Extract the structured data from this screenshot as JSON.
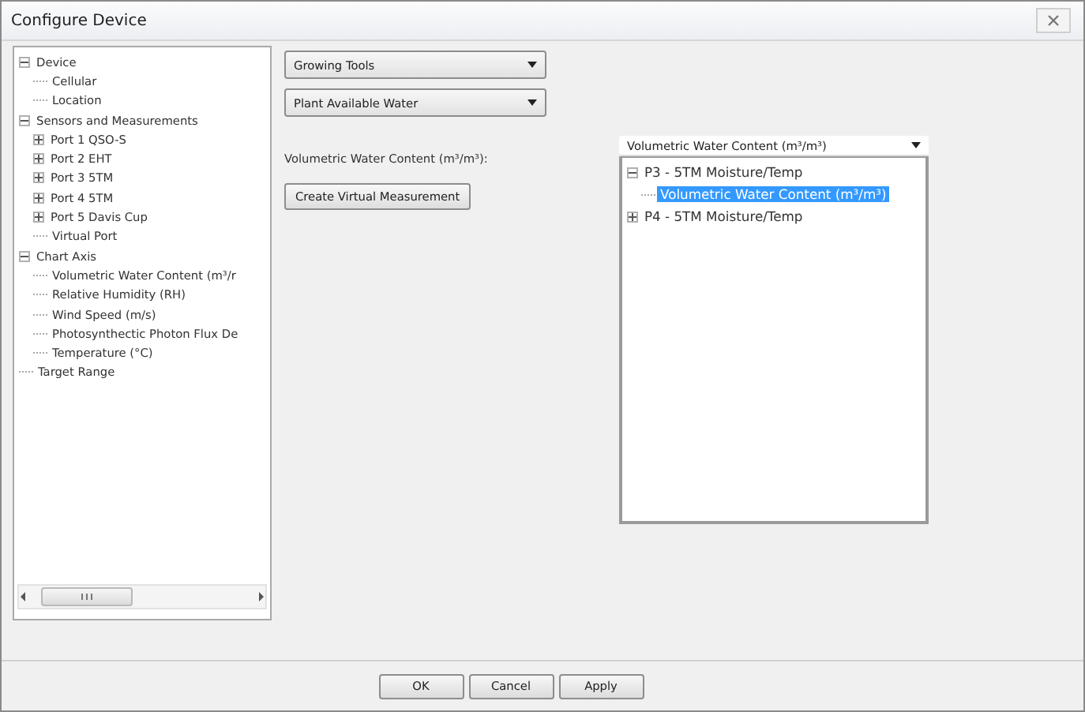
{
  "window": {
    "title": "Configure Device"
  },
  "settings_tree": [
    {
      "label": "Device",
      "expanded": true,
      "children": [
        {
          "label": "Cellular"
        },
        {
          "label": "Location"
        }
      ]
    },
    {
      "label": "Sensors and Measurements",
      "expanded": true,
      "children": [
        {
          "label": "Port 1  QSO-S",
          "expanded": false
        },
        {
          "label": "Port 2  EHT",
          "expanded": false
        },
        {
          "label": "Port 3  5TM",
          "expanded": false
        },
        {
          "label": "Port 4  5TM",
          "expanded": false
        },
        {
          "label": "Port 5  Davis Cup",
          "expanded": false
        },
        {
          "label": "Virtual Port"
        }
      ]
    },
    {
      "label": "Chart Axis",
      "expanded": true,
      "children": [
        {
          "label": "Volumetric Water Content (m³/r"
        },
        {
          "label": "Relative Humidity (RH)"
        },
        {
          "label": "Wind Speed (m/s)"
        },
        {
          "label": "Photosynthectic Photon Flux De"
        },
        {
          "label": "Temperature (°C)"
        }
      ]
    },
    {
      "label": "Target Range"
    }
  ],
  "tool_select": {
    "value": "Growing Tools"
  },
  "calc_select": {
    "value": "Plant Available Water"
  },
  "input_label": "Volumetric Water Content (m³/m³):",
  "create_button": "Create Virtual Measurement",
  "measurement_select": {
    "value": "Volumetric Water Content (m³/m³)"
  },
  "measurement_tree": [
    {
      "label": "P3 - 5TM Moisture/Temp",
      "expanded": true,
      "children": [
        {
          "label": "Volumetric Water Content (m³/m³)",
          "selected": true
        }
      ]
    },
    {
      "label": "P4 - 5TM Moisture/Temp",
      "expanded": false,
      "selected": false
    }
  ],
  "buttons": [
    "OK",
    "Cancel",
    "Apply"
  ]
}
